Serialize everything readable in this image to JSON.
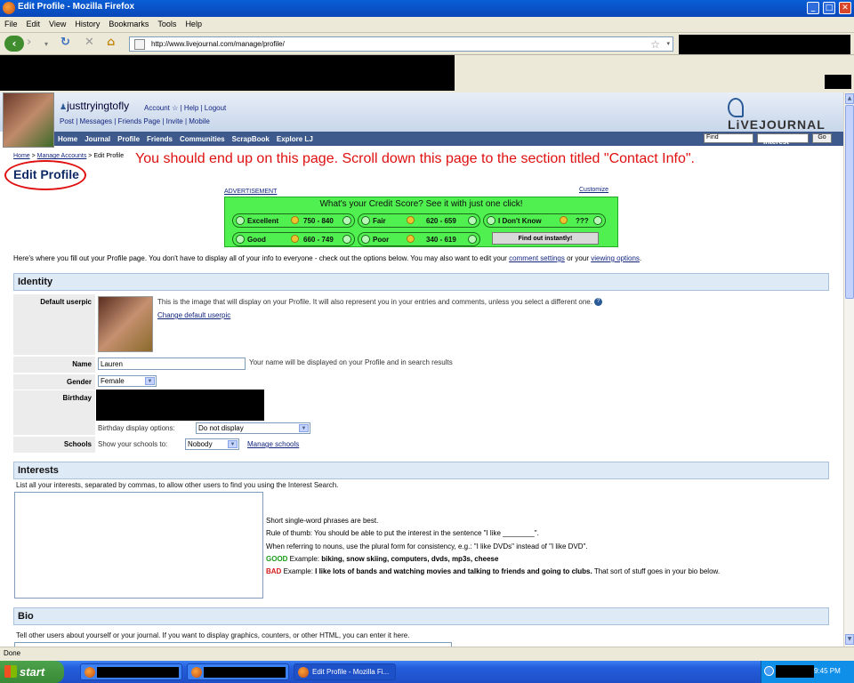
{
  "window": {
    "title": "Edit Profile - Mozilla Firefox"
  },
  "menu": [
    "File",
    "Edit",
    "View",
    "History",
    "Bookmarks",
    "Tools",
    "Help"
  ],
  "address": {
    "url": "http://www.livejournal.com/manage/profile/"
  },
  "lj": {
    "username": "justtryingtofly",
    "links_row1": "Account ☆ | Help | Logout",
    "links_row2": "Post | Messages | Friends Page | Invite | Mobile",
    "logo": "LiVEJOURNAL",
    "nav": [
      "Home",
      "Journal",
      "Profile",
      "Friends",
      "Communities",
      "ScrapBook",
      "Explore LJ"
    ],
    "find_placeholder": "Find",
    "search_type": "Interest",
    "go_label": "Go"
  },
  "breadcrumb": {
    "home": "Home",
    "sep1": " > ",
    "manage": "Manage Accounts",
    "sep2": " > ",
    "current": "Edit Profile"
  },
  "annotation": "You should end up on this page.  Scroll down this page to the section titled \"Contact Info\".",
  "page_title": "Edit Profile",
  "ad": {
    "label": "ADVERTISEMENT",
    "customize": "Customize",
    "headline": "What's your Credit Score? See it with just one click!",
    "options": [
      {
        "label": "Excellent",
        "range": "750 - 840"
      },
      {
        "label": "Fair",
        "range": "620 - 659"
      },
      {
        "label": "I Don't Know",
        "range": "???"
      },
      {
        "label": "Good",
        "range": "660 - 749"
      },
      {
        "label": "Poor",
        "range": "340 - 619"
      }
    ],
    "cta": "Find out instantly!"
  },
  "intro": {
    "text": "Here's where you fill out your Profile page. You don't have to display all of your info to everyone - check out the options below. You may also want to edit your ",
    "link1": "comment settings",
    "mid": " or your ",
    "link2": "viewing options",
    "end": "."
  },
  "identity": {
    "heading": "Identity",
    "userpic_label": "Default userpic",
    "userpic_desc": "This is the image that will display on your Profile. It will also represent you in your entries and comments, unless you select a different one.",
    "change_userpic": "Change default userpic",
    "name_label": "Name",
    "name_value": "Lauren",
    "name_help": "Your name will be displayed on your Profile and in search results",
    "gender_label": "Gender",
    "gender_value": "Female",
    "birthday_label": "Birthday",
    "birthday_display_label": "Birthday display options:",
    "birthday_display_value": "Do not display",
    "schools_label": "Schools",
    "schools_show": "Show your schools to:",
    "schools_value": "Nobody",
    "manage_schools": "Manage schools"
  },
  "interests": {
    "heading": "Interests",
    "desc": "List all your interests, separated by commas, to allow other users to find you using the Interest Search.",
    "tip1": "Short single-word phrases are best.",
    "tip2": "Rule of thumb: You should be able to put the interest in the sentence \"I like ________\".",
    "tip3": "When referring to nouns, use the plural form for consistency, e.g.: \"I like DVDs\" instead of \"I like DVD\".",
    "good_label": "GOOD",
    "good_text": " Example: ",
    "good_example": "biking, snow skiing, computers, dvds, mp3s, cheese",
    "bad_label": "BAD",
    "bad_text": " Example: ",
    "bad_example": "I like lots of bands and watching movies and talking to friends and going to clubs.",
    "bad_after": " That sort of stuff goes in your bio below."
  },
  "bio": {
    "heading": "Bio",
    "desc": "Tell other users about yourself or your journal. If you want to display graphics, counters, or other HTML, you can enter it here."
  },
  "status": "Done",
  "taskbar": {
    "start": "start",
    "active_task": "Edit Profile - Mozilla Fi...",
    "clock": "9:45 PM"
  }
}
